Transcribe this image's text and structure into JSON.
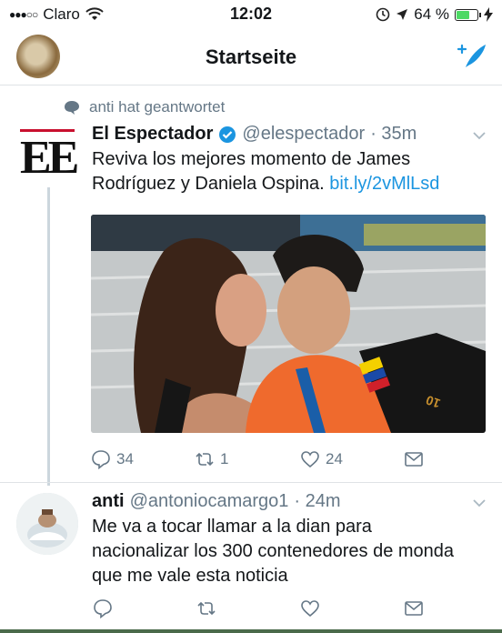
{
  "status_bar": {
    "carrier": "Claro",
    "time": "12:02",
    "battery": "64 %"
  },
  "nav": {
    "title": "Startseite"
  },
  "retweet_context": {
    "text": "anti hat geantwortet"
  },
  "tweet_1": {
    "avatar_text": "EE",
    "name": "El Espectador",
    "handle": "@elespectador",
    "time": "· 35m",
    "body": "Reviva los mejores momento de James Rodríguez y Daniela Ospina.",
    "link": "bit.ly/2vMlLsd",
    "replies": "34",
    "retweets": "1",
    "likes": "24"
  },
  "tweet_2": {
    "name": "anti",
    "handle": "@antoniocamargo1",
    "time": "· 24m",
    "body": "Me va a tocar llamar a la dian para nacionalizar los 300 contenedores de monda que me vale esta noticia"
  },
  "colors": {
    "accent": "#1b95e0",
    "muted": "#657786",
    "battery": "#4cd964",
    "ee_red": "#c8102e"
  },
  "icons": [
    "wifi-icon",
    "alarm-icon",
    "location-icon",
    "battery-icon",
    "charging-icon",
    "compose-icon",
    "speech-bubble-icon",
    "verified-icon",
    "caret-down-icon",
    "reply-icon",
    "retweet-icon",
    "like-icon",
    "dm-icon"
  ]
}
